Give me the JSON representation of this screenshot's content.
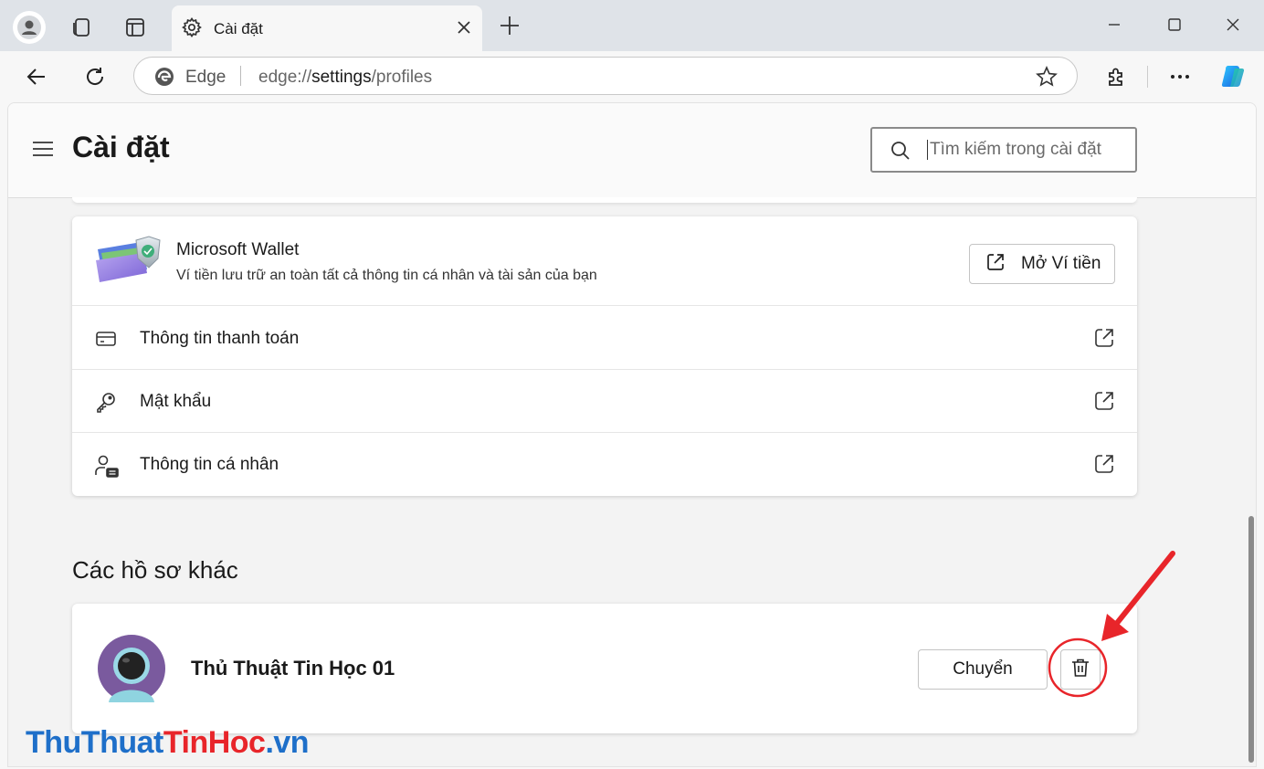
{
  "browser": {
    "tab_title": "Cài đặt",
    "omnibox_brand": "Edge",
    "url_prefix": "edge://",
    "url_highlight": "settings",
    "url_suffix": "/profiles"
  },
  "settings": {
    "page_title": "Cài đặt",
    "search_placeholder": "Tìm kiếm trong cài đặt"
  },
  "wallet": {
    "title": "Microsoft Wallet",
    "description": "Ví tiền lưu trữ an toàn tất cả thông tin cá nhân và tài sản của bạn",
    "open_button": "Mở Ví tiền",
    "items": [
      {
        "label": "Thông tin thanh toán",
        "icon": "credit-card-icon"
      },
      {
        "label": "Mật khẩu",
        "icon": "key-icon"
      },
      {
        "label": "Thông tin cá nhân",
        "icon": "person-card-icon"
      }
    ]
  },
  "other_profiles": {
    "section_title": "Các hồ sơ khác",
    "profiles": [
      {
        "name": "Thủ Thuật Tin Học 01",
        "switch_label": "Chuyển"
      }
    ]
  },
  "watermark": {
    "part1": "ThuThuat",
    "part2": "TinHoc",
    "part3": ".vn"
  },
  "colors": {
    "annotation_red": "#e8252a",
    "copilot_blue": "#1e88e5"
  }
}
